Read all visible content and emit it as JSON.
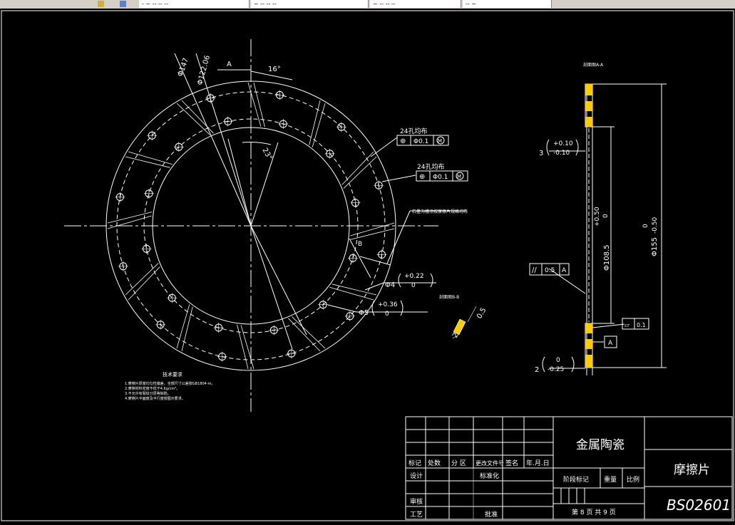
{
  "toolbar": {
    "tabs": [
      {
        "label": "- ~ -- -- --"
      },
      {
        "label": "~ -- -- --"
      },
      {
        "label": "~ -- -- --"
      },
      {
        "label": "-- ~"
      }
    ]
  },
  "drawing": {
    "background": "#000000",
    "line_color": "#ffffff",
    "highlight_color": "#ffcc00",
    "front_view": {
      "dim_phi_outer": "Φ147",
      "dim_phi_mid": "Φ122.06",
      "dim_a": "A",
      "dim_angle16": "16°",
      "dim_angle23": "23°",
      "holes_note_1": "24孔均布",
      "holes_note_2": "24孔均布",
      "fcf1": {
        "symbol": "⊕",
        "tol": "Φ0.1",
        "mod": "M"
      },
      "fcf2": {
        "symbol": "⊕",
        "tol": "Φ0.1",
        "mod": "M"
      },
      "groove_note": "石墨沟槽须按摩擦片规格均布",
      "dim_b": "B",
      "phi4": "Φ4",
      "phi4_tol_up": "+0.22",
      "phi4_tol_low": "0",
      "phi5": "Φ5",
      "phi5_tol_up": "+0.36",
      "phi5_tol_low": "0",
      "section_b_title": "剖面图B-B",
      "section_b_d1": "0.5",
      "section_b_d2": "2"
    },
    "side_view": {
      "title": "剖面图A-A",
      "dim3": "3",
      "dim3_up": "+0.10",
      "dim3_low": "-0.10",
      "phi108": "Φ108.5",
      "phi108_up": "+0.50",
      "phi108_low": "0",
      "phi155": "Φ155",
      "phi155_up": "0",
      "phi155_low": "-0.50",
      "parallel_sym": "//",
      "parallel_tol": "0.5",
      "parallel_ref": "A",
      "flat_sym": "▱",
      "flat_tol": "0.1",
      "datum": "A",
      "dim2": "2",
      "dim2_up": "0",
      "dim2_low": "-0.25"
    },
    "tech_req": {
      "title": "技术要求",
      "lines": [
        "1.摩擦片厚度均匀性偏差，全部尺寸公差按GB1804-m。",
        "2.摩擦材料密度不低于4.6g/cm³。",
        "3.不允许有裂纹分层等缺陷。",
        "4.摩擦片平面度及平行度按图示要求。"
      ]
    },
    "title_block": {
      "material": "金属陶瓷",
      "part_name": "摩擦片",
      "drawing_no": "BS02601",
      "h_biaoji": "标记",
      "h_chushu": "处数",
      "h_fenqu": "分 区",
      "h_wenjian": "更改文件号",
      "h_qianming": "签名",
      "h_date": "年.月.日",
      "h_sheji": "设计",
      "h_biaozhun": "标准化",
      "h_jieduan": "阶段标记",
      "h_zhongliang": "重量",
      "h_bili": "比例",
      "h_shenhe": "审核",
      "h_gongyi": "工艺",
      "h_pizhun": "批准",
      "sheet_info": "第 8 页  共 9 页"
    }
  }
}
